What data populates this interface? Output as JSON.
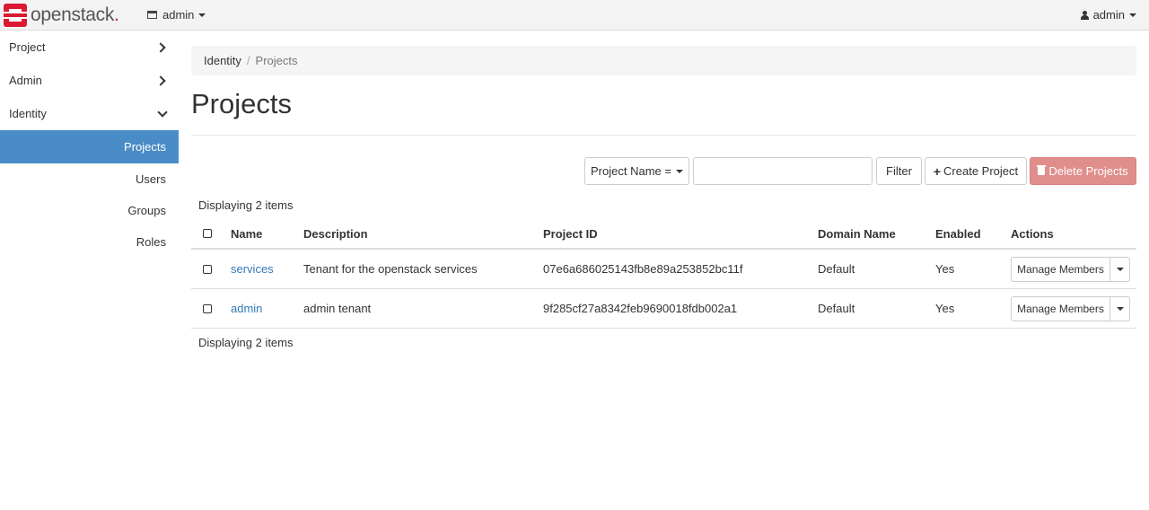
{
  "colors": {
    "brand_red": "#da1a32",
    "active_nav": "#4a8cc7",
    "danger": "#e08e8c",
    "link": "#337ab7"
  },
  "navbar": {
    "brand": {
      "name": "openstack",
      "dot": "."
    },
    "project_selector": {
      "label": "admin",
      "icon": "table-icon"
    },
    "user_menu": {
      "label": "admin",
      "icon": "user-icon"
    }
  },
  "sidebar": {
    "sections": [
      {
        "label": "Project"
      },
      {
        "label": "Admin"
      },
      {
        "label": "Identity"
      }
    ],
    "identity_items": [
      {
        "label": "Projects",
        "active": true
      },
      {
        "label": "Users"
      },
      {
        "label": "Groups"
      },
      {
        "label": "Roles"
      }
    ]
  },
  "breadcrumb": {
    "parent": "Identity",
    "separator": "/",
    "current": "Projects"
  },
  "page_title": "Projects",
  "toolbar": {
    "filter_field": "Project Name =",
    "filter_value": "",
    "filter_button": "Filter",
    "create_button": "Create Project",
    "delete_button": "Delete Projects"
  },
  "table": {
    "count_label": "Displaying 2 items",
    "columns": {
      "name": "Name",
      "description": "Description",
      "project_id": "Project ID",
      "domain": "Domain Name",
      "enabled": "Enabled",
      "actions": "Actions"
    },
    "rows": [
      {
        "name": "services",
        "description": "Tenant for the openstack services",
        "project_id": "07e6a686025143fb8e89a253852bc11f",
        "domain": "Default",
        "enabled": "Yes",
        "action": "Manage Members"
      },
      {
        "name": "admin",
        "description": "admin tenant",
        "project_id": "9f285cf27a8342feb9690018fdb002a1",
        "domain": "Default",
        "enabled": "Yes",
        "action": "Manage Members"
      }
    ]
  }
}
